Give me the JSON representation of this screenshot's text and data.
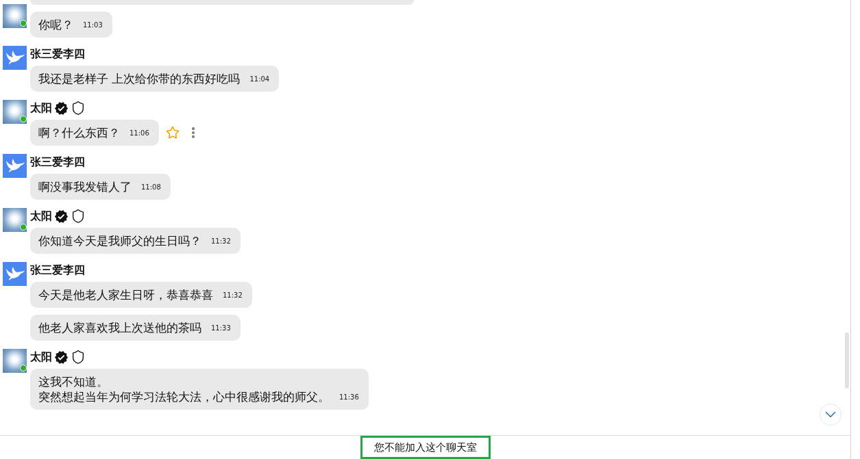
{
  "groups": [
    {
      "sender": {
        "avatar": {
          "kind": "sun"
        },
        "online": true
      },
      "messages": [
        {
          "lines": [
            "你呢？"
          ],
          "time": "11:03",
          "hovered": false
        }
      ]
    },
    {
      "sender": {
        "name": "张三爱李四",
        "avatar": {
          "kind": "dove"
        }
      },
      "messages": [
        {
          "lines": [
            "我还是老样子 上次给你带的东西好吃吗"
          ],
          "time": "11:04",
          "hovered": false
        }
      ]
    },
    {
      "sender": {
        "name": "太阳",
        "avatar": {
          "kind": "sun"
        },
        "online": true,
        "verified": true,
        "shield": true
      },
      "messages": [
        {
          "lines": [
            "啊？什么东西？"
          ],
          "time": "11:06",
          "hovered": true
        }
      ]
    },
    {
      "sender": {
        "name": "张三爱李四",
        "avatar": {
          "kind": "dove"
        }
      },
      "messages": [
        {
          "lines": [
            "啊没事我发错人了"
          ],
          "time": "11:08",
          "hovered": false
        }
      ]
    },
    {
      "sender": {
        "name": "太阳",
        "avatar": {
          "kind": "sun"
        },
        "online": true,
        "verified": true,
        "shield": true
      },
      "messages": [
        {
          "lines": [
            "你知道今天是我师父的生日吗？"
          ],
          "time": "11:32",
          "hovered": false
        }
      ]
    },
    {
      "sender": {
        "name": "张三爱李四",
        "avatar": {
          "kind": "dove"
        }
      },
      "messages": [
        {
          "lines": [
            "今天是他老人家生日呀，恭喜恭喜"
          ],
          "time": "11:32",
          "hovered": false
        },
        {
          "lines": [
            "他老人家喜欢我上次送他的茶吗"
          ],
          "time": "11:33",
          "hovered": false
        }
      ]
    },
    {
      "sender": {
        "name": "太阳",
        "avatar": {
          "kind": "sun"
        },
        "online": true,
        "verified": true,
        "shield": true
      },
      "messages": [
        {
          "lines": [
            "这我不知道。",
            "突然想起当年为何学习法轮大法，心中很感谢我的师父。"
          ],
          "time": "11:36",
          "hovered": false
        }
      ]
    }
  ],
  "footer": {
    "notice": "您不能加入这个聊天室"
  }
}
